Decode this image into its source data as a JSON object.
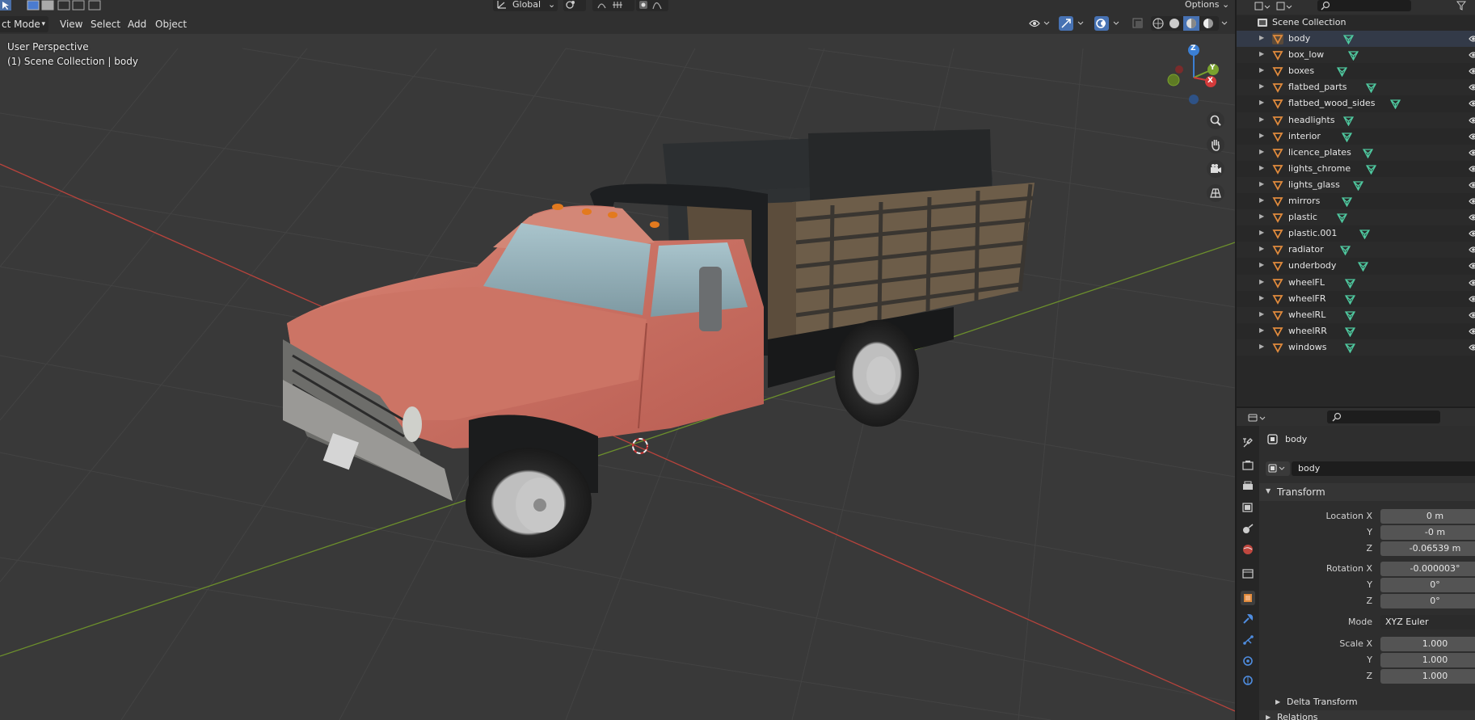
{
  "header": {
    "mode_label": "ct Mode",
    "menus": [
      "View",
      "Select",
      "Add",
      "Object"
    ],
    "transform_orientation": "Global",
    "options_label": "Options"
  },
  "viewport": {
    "perspective_label": "User Perspective",
    "collection_label": "(1) Scene Collection | body",
    "gizmo_axes": [
      "Z",
      "Y",
      "X"
    ]
  },
  "outliner": {
    "root_label": "Scene Collection",
    "items": [
      {
        "label": "body"
      },
      {
        "label": "box_low"
      },
      {
        "label": "boxes"
      },
      {
        "label": "flatbed_parts"
      },
      {
        "label": "flatbed_wood_sides"
      },
      {
        "label": "headlights"
      },
      {
        "label": "interior"
      },
      {
        "label": "licence_plates"
      },
      {
        "label": "lights_chrome"
      },
      {
        "label": "lights_glass"
      },
      {
        "label": "mirrors"
      },
      {
        "label": "plastic"
      },
      {
        "label": "plastic.001"
      },
      {
        "label": "radiator"
      },
      {
        "label": "underbody"
      },
      {
        "label": "wheelFL"
      },
      {
        "label": "wheelFR"
      },
      {
        "label": "wheelRL"
      },
      {
        "label": "wheelRR"
      },
      {
        "label": "windows"
      }
    ]
  },
  "properties": {
    "object_name": "body",
    "object_name_field": "body",
    "transform_title": "Transform",
    "location_x_label": "Location X",
    "location_x": "0 m",
    "location_y_label": "Y",
    "location_y": "-0 m",
    "location_z_label": "Z",
    "location_z": "-0.06539 m",
    "rotation_x_label": "Rotation X",
    "rotation_x": "-0.000003°",
    "rotation_y_label": "Y",
    "rotation_y": "0°",
    "rotation_z_label": "Z",
    "rotation_z": "0°",
    "mode_label": "Mode",
    "mode_value": "XYZ Euler",
    "scale_x_label": "Scale X",
    "scale_x": "1.000",
    "scale_y_label": "Y",
    "scale_y": "1.000",
    "scale_z_label": "Z",
    "scale_z": "1.000",
    "delta_transform_title": "Delta Transform",
    "relations_title": "Relations"
  },
  "colors": {
    "x_axis": "#d33a3a",
    "y_axis": "#7aa22e",
    "z_axis": "#3b7fd4",
    "object_orange": "#e08a3c",
    "mesh_green": "#4fc9a0",
    "active_row": "#333a48"
  }
}
